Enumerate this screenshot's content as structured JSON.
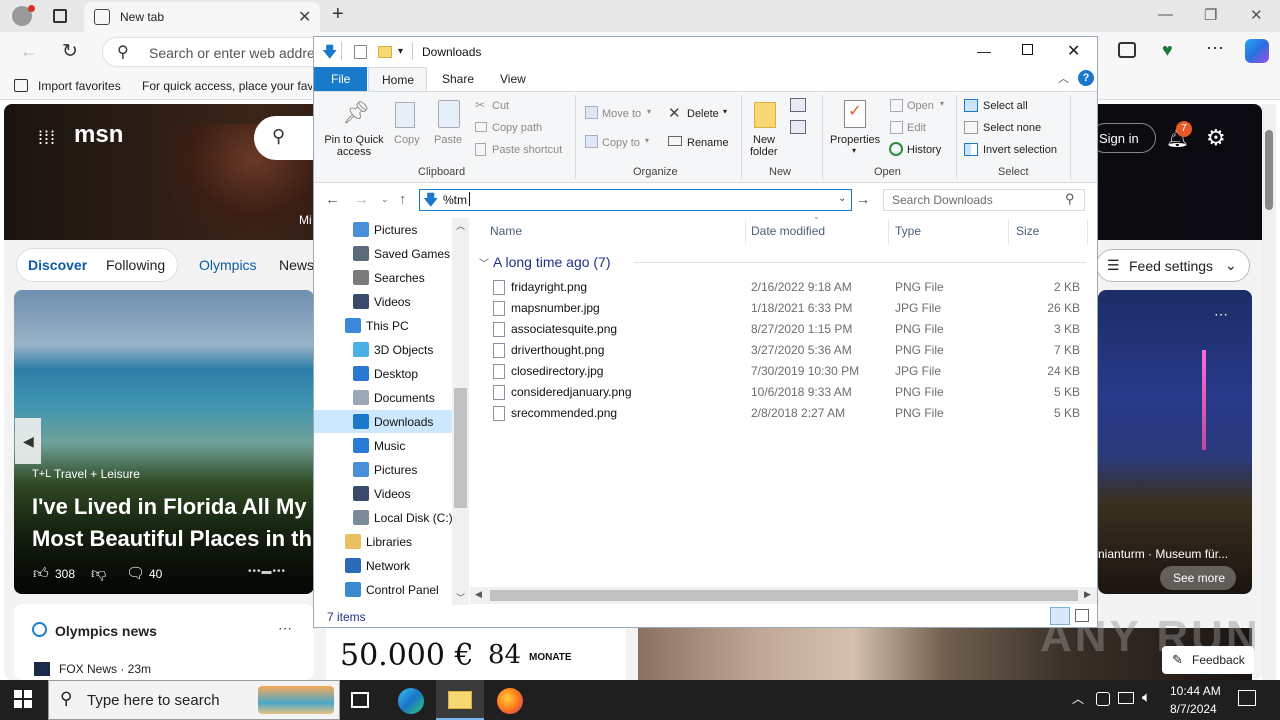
{
  "browser": {
    "tab_title": "New tab",
    "omnibox_placeholder": "Search or enter web address",
    "fav_import": "Import favorites",
    "fav_hint": "For quick access, place your favorites here on the favorites bar."
  },
  "msn": {
    "logo": "msn",
    "hero_partial": "Mi",
    "signin": "Sign in",
    "notif_count": "7",
    "nav": {
      "discover": "Discover",
      "following": "Following",
      "olympics": "Olympics",
      "news": "News"
    },
    "feed_settings": "Feed settings",
    "card1": {
      "source": "Travel + Leisure",
      "title_line1": "I've Lived in Florida All My",
      "title_line2": "Most Beautiful Places in th",
      "likes": "308",
      "comments": "40"
    },
    "card2": {
      "caption": "nianturm · Museum für...",
      "see_more": "See more"
    },
    "olympics_news": {
      "title": "Olympics news",
      "source": "FOX News · 23m"
    },
    "ad": {
      "amount": "50.000 €",
      "months": "84",
      "months_label": "MONATE"
    },
    "feedback": "Feedback",
    "watermark": "ANY RUN"
  },
  "explorer": {
    "title": "Downloads",
    "tabs": {
      "file": "File",
      "home": "Home",
      "share": "Share",
      "view": "View"
    },
    "ribbon": {
      "pin": "Pin to Quick access",
      "copy": "Copy",
      "paste": "Paste",
      "cut": "Cut",
      "copy_path": "Copy path",
      "paste_shortcut": "Paste shortcut",
      "clipboard": "Clipboard",
      "move_to": "Move to",
      "copy_to": "Copy to",
      "delete": "Delete",
      "rename": "Rename",
      "organize": "Organize",
      "new_folder_1": "New",
      "new_folder_2": "folder",
      "new": "New",
      "properties": "Properties",
      "open": "Open",
      "edit": "Edit",
      "history": "History",
      "open_group": "Open",
      "select_all": "Select all",
      "select_none": "Select none",
      "invert_selection": "Invert selection",
      "select": "Select"
    },
    "address": "%tm",
    "search_placeholder": "Search Downloads",
    "nav": [
      {
        "label": "Pictures",
        "indent": 1,
        "icon": "pictures-icon"
      },
      {
        "label": "Saved Games",
        "indent": 1,
        "icon": "saved-games-icon"
      },
      {
        "label": "Searches",
        "indent": 1,
        "icon": "searches-icon"
      },
      {
        "label": "Videos",
        "indent": 1,
        "icon": "videos-icon"
      },
      {
        "label": "This PC",
        "indent": 0,
        "icon": "this-pc-icon"
      },
      {
        "label": "3D Objects",
        "indent": 1,
        "icon": "3d-objects-icon"
      },
      {
        "label": "Desktop",
        "indent": 1,
        "icon": "desktop-icon"
      },
      {
        "label": "Documents",
        "indent": 1,
        "icon": "documents-icon"
      },
      {
        "label": "Downloads",
        "indent": 1,
        "icon": "downloads-icon"
      },
      {
        "label": "Music",
        "indent": 1,
        "icon": "music-icon"
      },
      {
        "label": "Pictures",
        "indent": 1,
        "icon": "pictures-icon"
      },
      {
        "label": "Videos",
        "indent": 1,
        "icon": "videos-icon"
      },
      {
        "label": "Local Disk (C:)",
        "indent": 1,
        "icon": "disk-icon"
      },
      {
        "label": "Libraries",
        "indent": 0,
        "icon": "libraries-icon"
      },
      {
        "label": "Network",
        "indent": 0,
        "icon": "network-icon"
      },
      {
        "label": "Control Panel",
        "indent": 0,
        "icon": "control-panel-icon"
      }
    ],
    "columns": {
      "name": "Name",
      "date": "Date modified",
      "type": "Type",
      "size": "Size"
    },
    "group": "A long time ago (7)",
    "files": [
      {
        "name": "fridayright.png",
        "date": "2/16/2022 9:18 AM",
        "type": "PNG File",
        "size": "2 KB"
      },
      {
        "name": "mapsnumber.jpg",
        "date": "1/18/2021 6:33 PM",
        "type": "JPG File",
        "size": "26 KB"
      },
      {
        "name": "associatesquite.png",
        "date": "8/27/2020 1:15 PM",
        "type": "PNG File",
        "size": "3 KB"
      },
      {
        "name": "driverthought.png",
        "date": "3/27/2020 5:36 AM",
        "type": "PNG File",
        "size": "7 KB"
      },
      {
        "name": "closedirectory.jpg",
        "date": "7/30/2019 10:30 PM",
        "type": "JPG File",
        "size": "24 KB"
      },
      {
        "name": "consideredjanuary.png",
        "date": "10/6/2018 9:33 AM",
        "type": "PNG File",
        "size": "5 KB"
      },
      {
        "name": "srecommended.png",
        "date": "2/8/2018 2:27 AM",
        "type": "PNG File",
        "size": "5 KB"
      }
    ],
    "status": "7 items"
  },
  "taskbar": {
    "search_placeholder": "Type here to search",
    "time": "10:44 AM",
    "date": "8/7/2024"
  }
}
